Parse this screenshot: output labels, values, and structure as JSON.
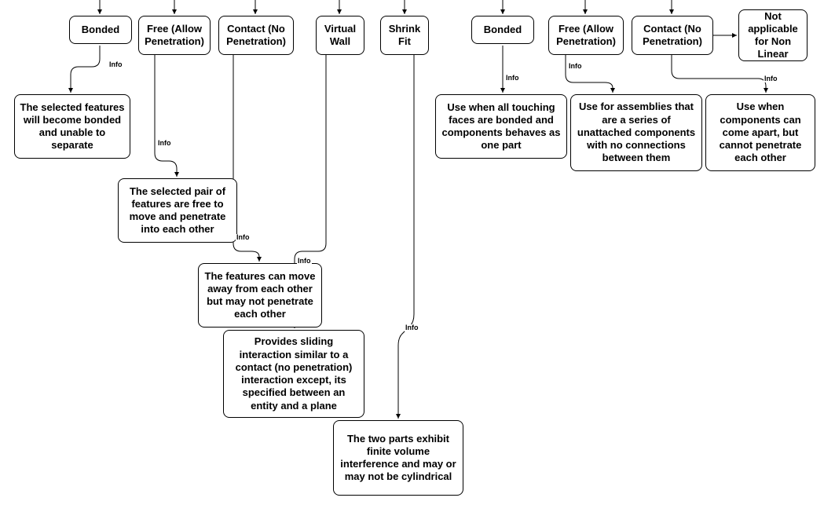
{
  "labels": {
    "info": "Info"
  },
  "left": {
    "headers": {
      "bonded": "Bonded",
      "free": "Free (Allow Penetration)",
      "contact": "Contact (No Penetration)",
      "virtual": "Virtual Wall",
      "shrink": "Shrink Fit"
    },
    "infos": {
      "bonded": "The selected features will become bonded and unable to separate",
      "free": "The selected pair of features are free to move and penetrate into each other",
      "contact": "The features can move away from each other but may not penetrate each other",
      "virtual": "Provides sliding interaction similar to a contact (no penetration) interaction except, its specified between an entity and a plane",
      "shrink": "The two parts exhibit finite volume interference and may or may not be cylindrical"
    }
  },
  "right": {
    "headers": {
      "bonded": "Bonded",
      "free": "Free (Allow Penetration)",
      "contact": "Contact (No Penetration)",
      "na": "Not applicable for Non Linear"
    },
    "infos": {
      "bonded": "Use when all touching faces are bonded and components behaves as one part",
      "free": "Use for assemblies that are a series of unattached components with no connections between them",
      "contact": "Use when components can come apart, but cannot penetrate each other"
    }
  }
}
